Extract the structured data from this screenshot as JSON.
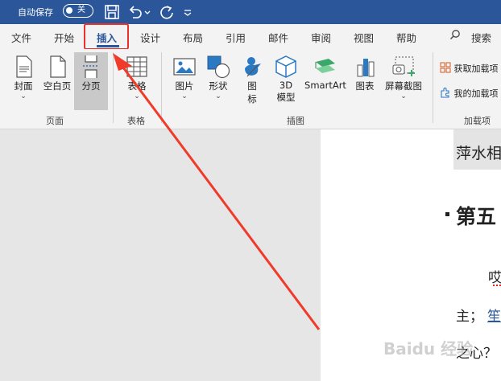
{
  "titlebar": {
    "autosave_label": "自动保存",
    "toggle_state": "关"
  },
  "tabs": [
    {
      "label": "文件"
    },
    {
      "label": "开始"
    },
    {
      "label": "插入",
      "active": true
    },
    {
      "label": "设计"
    },
    {
      "label": "布局"
    },
    {
      "label": "引用"
    },
    {
      "label": "邮件"
    },
    {
      "label": "审阅"
    },
    {
      "label": "视图"
    },
    {
      "label": "帮助"
    }
  ],
  "search_label": "搜索",
  "ribbon": {
    "pages": {
      "cover": "封面",
      "blank": "空白页",
      "break": "分页",
      "group": "页面"
    },
    "tables": {
      "table": "表格",
      "group": "表格"
    },
    "illustrations": {
      "pictures": "图片",
      "shapes": "形状",
      "icons_line1": "图",
      "icons_line2": "标",
      "model3d_line1": "3D",
      "model3d_line2": "模型",
      "smartart": "SmartArt",
      "chart": "图表",
      "screenshot": "屏幕截图",
      "group": "插图"
    },
    "addins": {
      "get": "获取加载项",
      "my": "我的加载项",
      "group": "加载项"
    }
  },
  "document": {
    "line1": "萍水相",
    "heading": "第五",
    "line2": "哎",
    "line3": "主；",
    "line3b": "笙",
    "line4": "之心？"
  },
  "watermark": "Baidu 经验",
  "colors": {
    "accent": "#2b579a",
    "highlight": "#e8332c",
    "arrow": "#f03a2a"
  }
}
